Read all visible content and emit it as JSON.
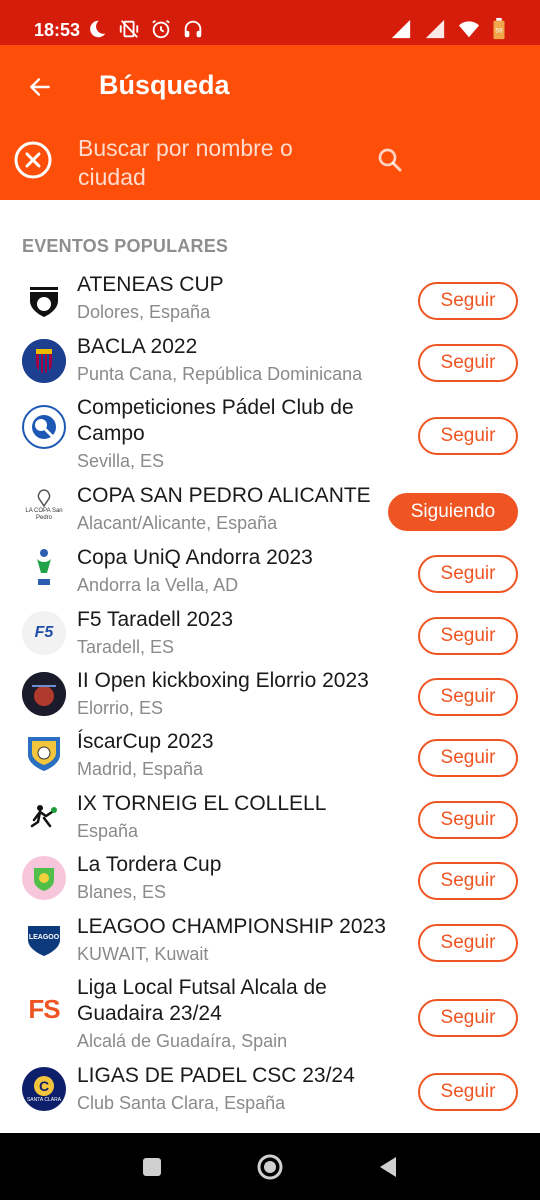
{
  "status_bar": {
    "time": "18:53",
    "icons_left": [
      "moon-icon",
      "vibrate-off-icon",
      "alarm-icon",
      "headphones-icon"
    ],
    "icons_right": [
      "signal-icon",
      "signal-icon",
      "wifi-icon",
      "battery-icon"
    ],
    "battery_level": "59"
  },
  "header": {
    "title": "Búsqueda",
    "back_icon": "arrow-left-icon"
  },
  "search": {
    "placeholder": "Buscar por nombre o ciudad",
    "clear_icon": "close-circle-icon",
    "search_icon": "search-icon"
  },
  "section": {
    "heading": "EVENTOS POPULARES"
  },
  "events": [
    {
      "name": "ATENEAS CUP",
      "location": "Dolores, España",
      "button": "Seguir",
      "following": false
    },
    {
      "name": "BACLA 2022",
      "location": "Punta Cana, República Dominicana",
      "button": "Seguir",
      "following": false
    },
    {
      "name": "Competiciones Pádel Club de Campo",
      "location": "Sevilla, ES",
      "button": "Seguir",
      "following": false
    },
    {
      "name": "COPA SAN PEDRO ALICANTE",
      "location": "Alacant/Alicante, España",
      "button": "Siguiendo",
      "following": true,
      "logo_text": "LA COPA San Pedro"
    },
    {
      "name": "Copa UniQ Andorra 2023",
      "location": "Andorra la Vella, AD",
      "button": "Seguir",
      "following": false
    },
    {
      "name": "F5 Taradell 2023",
      "location": "Taradell, ES",
      "button": "Seguir",
      "following": false,
      "logo_text": "F5"
    },
    {
      "name": "II Open kickboxing Elorrio 2023",
      "location": "Elorrio, ES",
      "button": "Seguir",
      "following": false
    },
    {
      "name": "ÍscarCup 2023",
      "location": "Madrid, España",
      "button": "Seguir",
      "following": false
    },
    {
      "name": "IX TORNEIG EL COLLELL",
      "location": "España",
      "button": "Seguir",
      "following": false
    },
    {
      "name": "La Tordera Cup",
      "location": "Blanes, ES",
      "button": "Seguir",
      "following": false
    },
    {
      "name": "LEAGOO CHAMPIONSHIP 2023",
      "location": "KUWAIT, Kuwait",
      "button": "Seguir",
      "following": false,
      "logo_text": "LEAGOO"
    },
    {
      "name": "Liga Local Futsal Alcala de Guadaira 23/24",
      "location": "Alcalá de Guadaíra, Spain",
      "button": "Seguir",
      "following": false,
      "logo_text": "FS"
    },
    {
      "name": "LIGAS DE PADEL CSC 23/24",
      "location": "Club Santa Clara, España",
      "button": "Seguir",
      "following": false,
      "logo_text": "SANTA CLARA"
    }
  ],
  "colors": {
    "status_bar": "#d61d0c",
    "app_bar": "#fd4f0a",
    "accent": "#ef5522"
  },
  "nav": [
    "recents-icon",
    "home-icon",
    "back-icon"
  ]
}
